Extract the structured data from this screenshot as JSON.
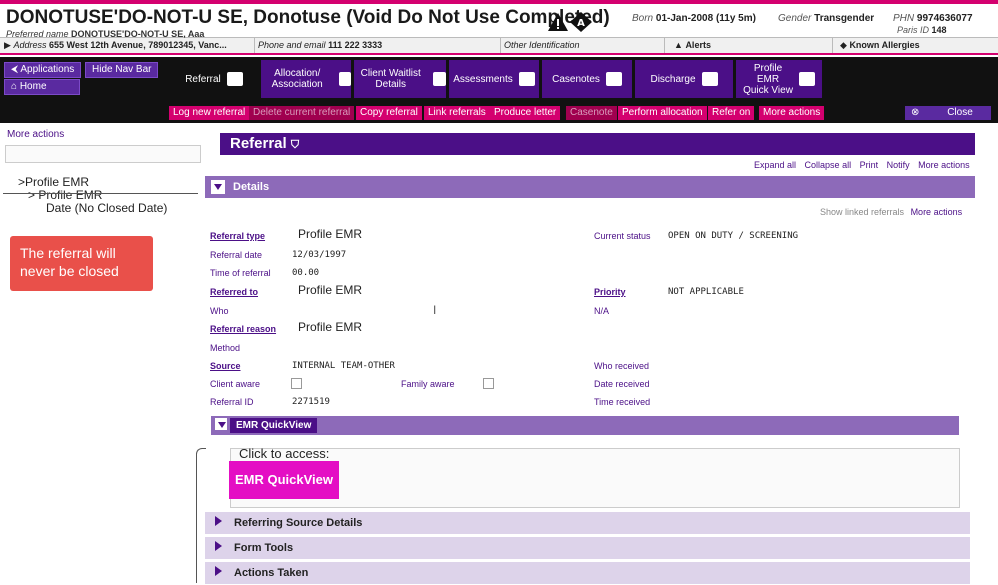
{
  "header": {
    "patient_name": "DONOTUSE'DO-NOT-U SE, Donotuse (Void Do Not Use Completed)",
    "preferred_label": "Preferred name",
    "preferred_value": "DONOTUSE'DO-NOT-U SE, Aaa",
    "born_label": "Born",
    "born_value": "01-Jan-2008 (11y 5m)",
    "gender_label": "Gender",
    "gender_value": "Transgender",
    "phn_label": "PHN",
    "phn_value": "9974636077",
    "paris_label": "Paris ID",
    "paris_value": "148"
  },
  "infobar": {
    "address_label": "Address",
    "address_value": "655 West 12th Avenue, 789012345, Vanc...",
    "phone_label": "Phone and email",
    "phone_value": "111 222 3333",
    "other_id": "Other Identification",
    "alerts": "Alerts",
    "allergies": "Known Allergies"
  },
  "nav": {
    "applications": "Applications",
    "hide_nav": "Hide Nav Bar",
    "home": "Home",
    "modules": [
      "Referral",
      "Allocation/ Association",
      "Client Waitlist Details",
      "Assessments",
      "Casenotes",
      "Discharge",
      "Profile EMR Quick View"
    ]
  },
  "actions": {
    "items": [
      "Log new referral",
      "Delete current referral",
      "Copy referral",
      "Link referrals",
      "Produce letter",
      "Casenote",
      "Perform allocation",
      "Refer on",
      "More actions"
    ],
    "close": "Close"
  },
  "sidebar": {
    "more_actions": "More actions",
    "tree": [
      ">Profile EMR",
      "> Profile EMR",
      "Date (No Closed Date)"
    ],
    "callout": "The referral will never be closed"
  },
  "main": {
    "title": "Referral",
    "links": [
      "Expand all",
      "Collapse all",
      "Print",
      "Notify",
      "More actions"
    ],
    "details_title": "Details",
    "show_linked": "Show linked referrals",
    "more_actions": "More actions",
    "fields": {
      "referral_type_label": "Referral type",
      "referral_type_value": "Profile EMR",
      "referral_date_label": "Referral date",
      "referral_date_value": "12/03/1997",
      "time_label": "Time of referral",
      "time_value": "00.00",
      "referred_to_label": "Referred to",
      "referred_to_value": "Profile EMR",
      "who_label": "Who",
      "reason_label": "Referral reason",
      "reason_value": "Profile EMR",
      "method_label": "Method",
      "source_label": "Source",
      "source_value": "INTERNAL TEAM-OTHER",
      "client_aware_label": "Client aware",
      "family_aware_label": "Family aware",
      "referral_id_label": "Referral ID",
      "referral_id_value": "2271519",
      "status_label": "Current status",
      "status_value": "OPEN ON DUTY / SCREENING",
      "priority_label": "Priority",
      "priority_value": "NOT APPLICABLE",
      "na_value": "N/A",
      "who_received_label": "Who received",
      "date_received_label": "Date received",
      "time_received_label": "Time received"
    },
    "quickview_title": "EMR QuickView",
    "click_access": "Click to access:",
    "emr_button": "EMR QuickView",
    "sections": [
      "Referring Source Details",
      "Form Tools",
      "Actions Taken"
    ]
  }
}
